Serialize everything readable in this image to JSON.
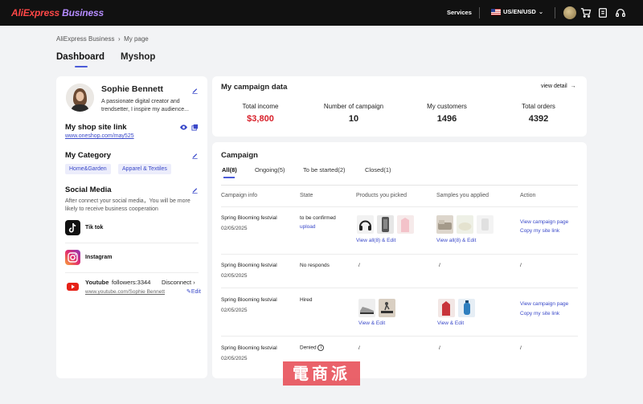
{
  "topbar": {
    "logo_part1": "AliExpress",
    "logo_part2": " Business",
    "services": "Services",
    "locale": "US/EN/USD"
  },
  "breadcrumb": {
    "home": "AliExpress Business",
    "sep": ">",
    "current": "My page"
  },
  "tabs": {
    "dashboard": "Dashboard",
    "myshop": "Myshop"
  },
  "profile": {
    "name": "Sophie Bennett",
    "bio": "A passionate digital creator and trendsetter, I inspire my audience...",
    "shop_link_title": "My shop site link",
    "shop_link": "www.oneshop.com/may525",
    "category_title": "My Category",
    "categories": [
      "Home&Garden",
      "Apparel & Textiles"
    ],
    "social_title": "Social Media",
    "social_note": "After connect your social media，You will be more likely to receive business cooperation",
    "tiktok": "Tik tok",
    "instagram": "Instagram",
    "youtube": "Youtube",
    "youtube_followers": "followers:3344",
    "youtube_disconnect": "Disconnect",
    "youtube_url": "www.youtube.com/Sophie Bennett",
    "youtube_edit": "Edit"
  },
  "campaign_data": {
    "title": "My campaign data",
    "view_detail": "view detail",
    "stats": [
      {
        "label": "Total income",
        "value": "$3,800"
      },
      {
        "label": "Number of campaign",
        "value": "10"
      },
      {
        "label": "My customers",
        "value": "1496"
      },
      {
        "label": "Total orders",
        "value": "4392"
      }
    ]
  },
  "campaign": {
    "title": "Campaign",
    "tabs": [
      "All(8)",
      "Ongoing(5)",
      "To be started(2)",
      "Closed(1)"
    ],
    "headers": [
      "Campaign info",
      "State",
      "Products you picked",
      "Samples you applied",
      "Action"
    ],
    "rows": [
      {
        "name": "Spring Blooming festvial",
        "date": "02/05/2025",
        "state": "to be confirmed",
        "state_link": "upload",
        "products_link": "View all(8) & Edit",
        "samples_link": "View all(8) & Edit",
        "action1": "View campaign page",
        "action2": "Copy my site link"
      },
      {
        "name": "Spring Blooming festvial",
        "date": "02/05/2025",
        "state": "No responds",
        "products": "/",
        "samples": "/",
        "action": "/"
      },
      {
        "name": "Spring Blooming festvial",
        "date": "02/05/2025",
        "state": "Hired",
        "products_link": "View & Edit",
        "samples_link": "View & Edit",
        "action1": "View campaign page",
        "action2": "Copy my site link"
      },
      {
        "name": "Spring Blooming festvial",
        "date": "02/05/2025",
        "state": "Denied",
        "products": "/",
        "samples": "/",
        "action": "/"
      }
    ]
  },
  "watermark": "電商派",
  "colors": {
    "accent": "#4b5bd8",
    "link": "#3a49c9",
    "income": "#d8202a",
    "topbar": "#111111"
  }
}
